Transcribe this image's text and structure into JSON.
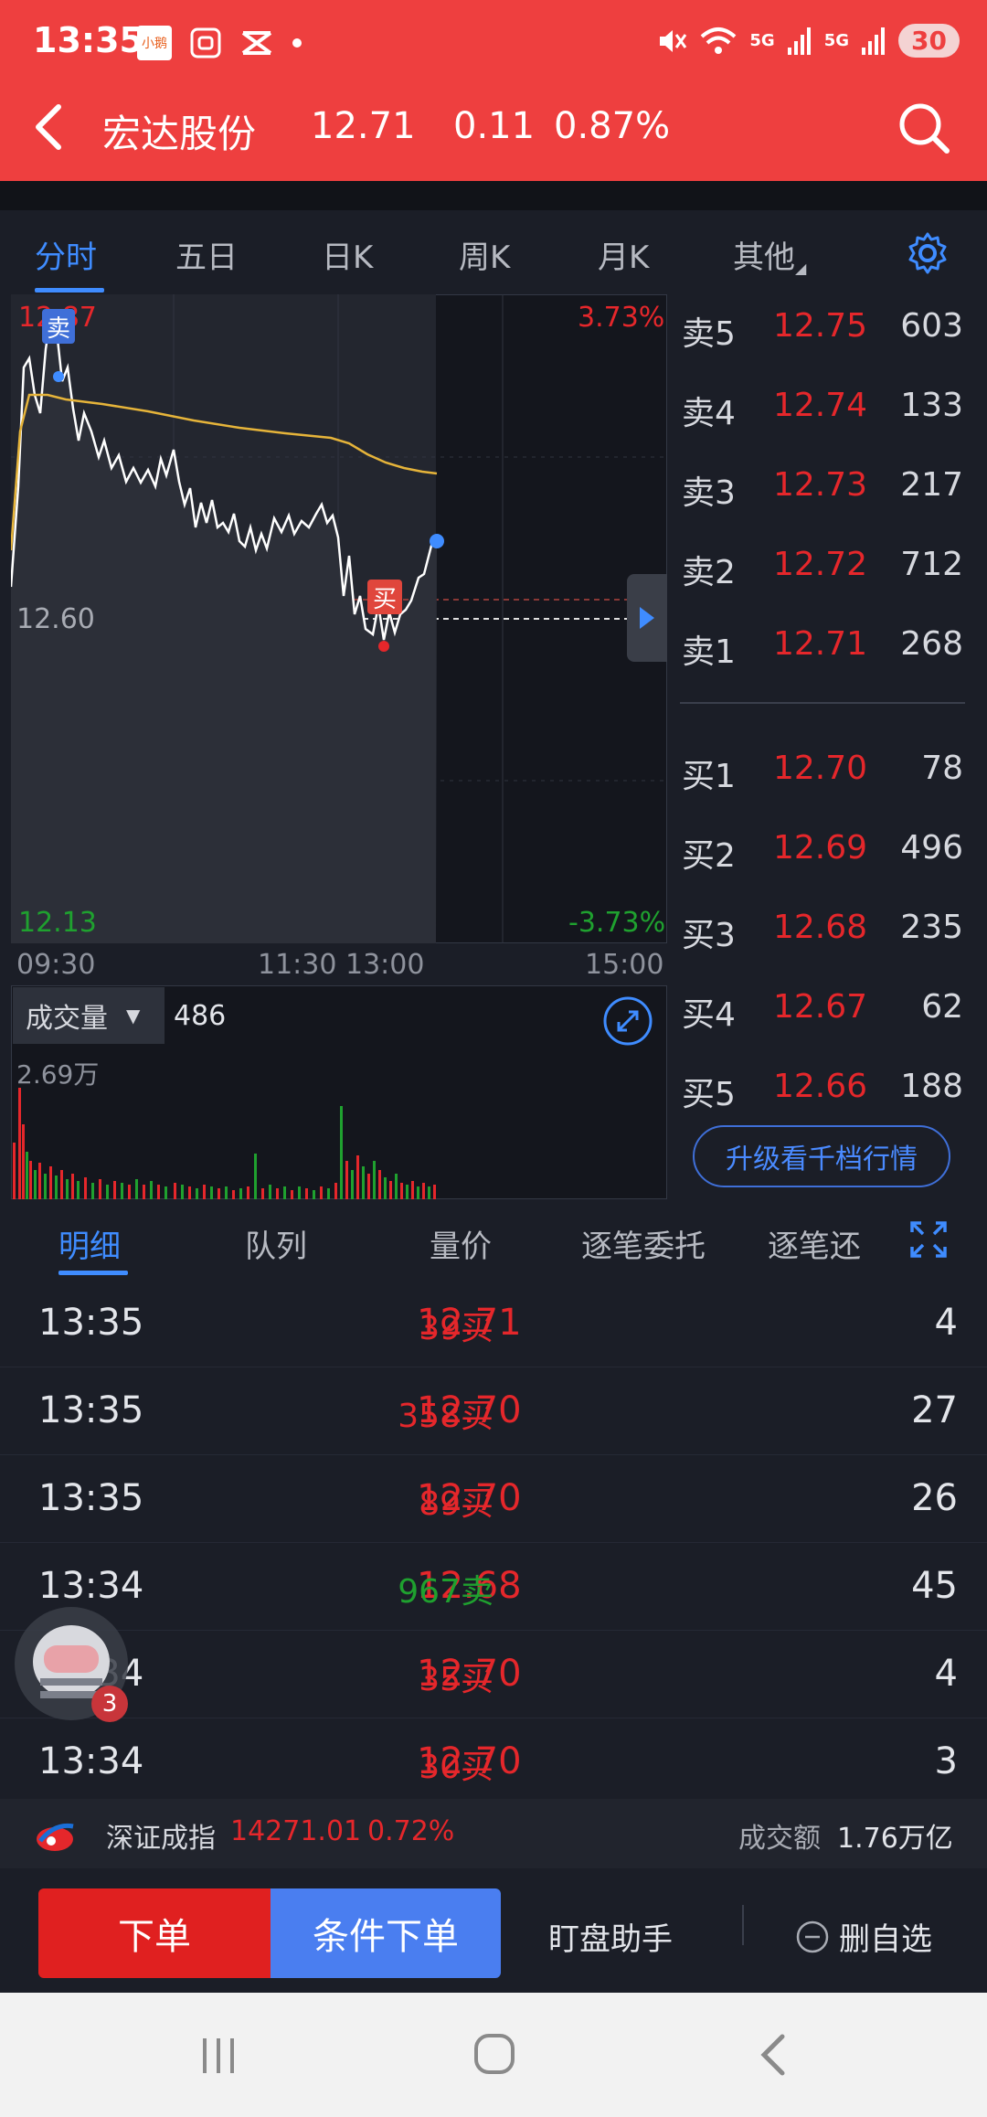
{
  "status": {
    "time": "13:35",
    "app_badge": "小鹅",
    "net1": "5G",
    "net2": "5G",
    "battery": "30"
  },
  "header": {
    "stock_name": "宏达股份",
    "price": "12.71",
    "change": "0.11",
    "change_pct": "0.87%"
  },
  "tabs": [
    "分时",
    "五日",
    "日K",
    "周K",
    "月K",
    "其他"
  ],
  "chart": {
    "top_price": "12.87",
    "top_pct": "3.73%",
    "ref_price": "12.60",
    "bottom_price": "12.13",
    "bottom_pct": "-3.73%",
    "sell_marker": "卖",
    "buy_marker": "买",
    "times": [
      "09:30",
      "11:30 13:00",
      "15:00"
    ],
    "volume_label": "成交量",
    "volume_value": "486",
    "volume_max": "2.69万"
  },
  "order_book": {
    "asks": [
      {
        "label": "卖5",
        "price": "12.75",
        "qty": "603"
      },
      {
        "label": "卖4",
        "price": "12.74",
        "qty": "133"
      },
      {
        "label": "卖3",
        "price": "12.73",
        "qty": "217"
      },
      {
        "label": "卖2",
        "price": "12.72",
        "qty": "712"
      },
      {
        "label": "卖1",
        "price": "12.71",
        "qty": "268"
      }
    ],
    "bids": [
      {
        "label": "买1",
        "price": "12.70",
        "qty": "78"
      },
      {
        "label": "买2",
        "price": "12.69",
        "qty": "496"
      },
      {
        "label": "买3",
        "price": "12.68",
        "qty": "235"
      },
      {
        "label": "买4",
        "price": "12.67",
        "qty": "62"
      },
      {
        "label": "买5",
        "price": "12.66",
        "qty": "188"
      }
    ],
    "upgrade": "升级看千档行情"
  },
  "detail_tabs": [
    "明细",
    "队列",
    "量价",
    "逐笔委托",
    "逐笔还"
  ],
  "trades": [
    {
      "time": "13:35",
      "price": "12.71",
      "vol": "39买",
      "side": "buy",
      "num": "4"
    },
    {
      "time": "13:35",
      "price": "12.70",
      "vol": "358买",
      "side": "buy",
      "num": "27"
    },
    {
      "time": "13:35",
      "price": "12.70",
      "vol": "89买",
      "side": "buy",
      "num": "26"
    },
    {
      "time": "13:34",
      "price": "12.68",
      "vol": "967卖",
      "side": "sell",
      "num": "45"
    },
    {
      "time": "13:34",
      "price": "12.70",
      "vol": "35买",
      "side": "buy",
      "num": "4"
    },
    {
      "time": "13:34",
      "price": "12.70",
      "vol": "30买",
      "side": "buy",
      "num": "3"
    }
  ],
  "float_badge": "3",
  "index_bar": {
    "name": "深证成指",
    "value": "14271.01",
    "pct": "0.72%",
    "amount_label": "成交额",
    "amount": "1.76万亿"
  },
  "actions": {
    "order": "下单",
    "conditional": "条件下单",
    "helper": "盯盘助手",
    "remove": "删自选"
  },
  "colors": {
    "up": "#e5272b",
    "down": "#1fa12f",
    "accent": "#3f8cff",
    "header": "#ee3f3f"
  }
}
